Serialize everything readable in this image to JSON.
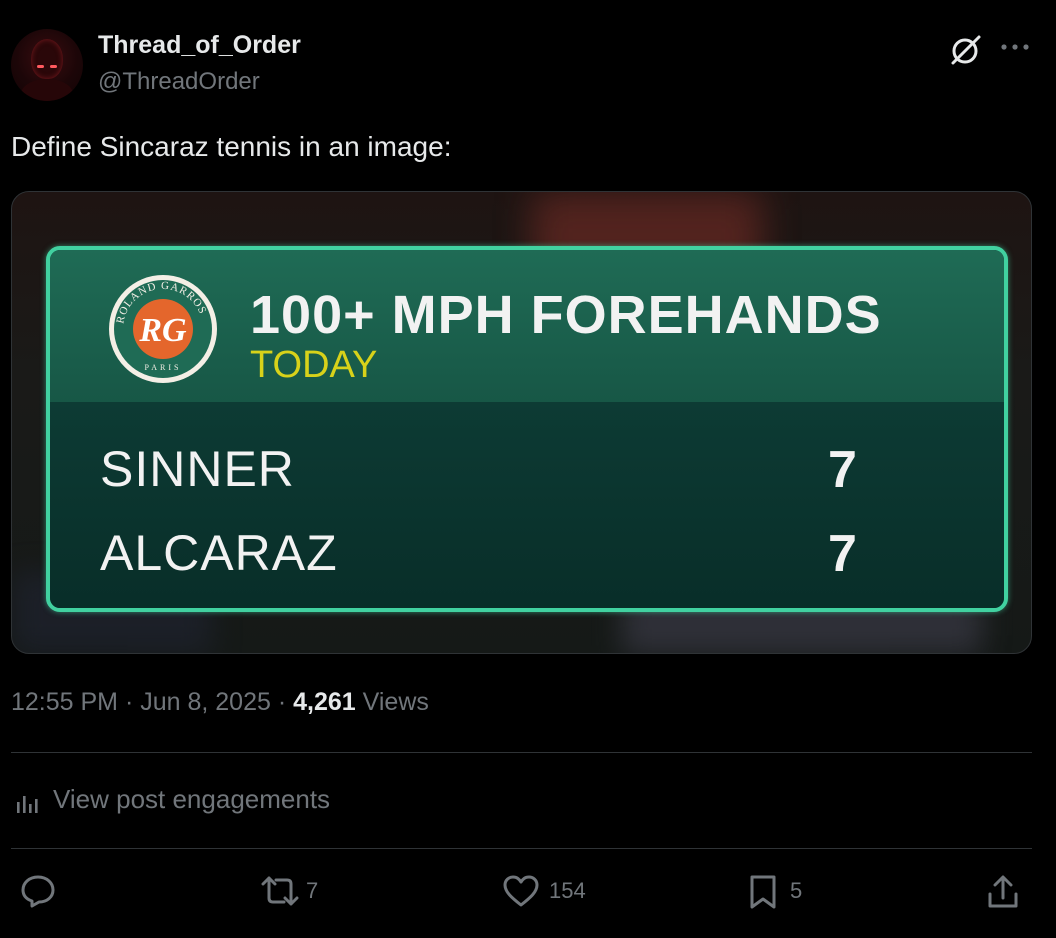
{
  "author": {
    "display_name": "Thread_of_Order",
    "handle": "@ThreadOrder"
  },
  "header_icons": [
    "grok-icon",
    "more-icon"
  ],
  "tweet": {
    "text": "Define Sincaraz tennis in an image:"
  },
  "media": {
    "logo_text": "ROLAND GARROS · PARIS",
    "title": "100+ MPH FOREHANDS",
    "subtitle": "TODAY",
    "rows": [
      {
        "player": "SINNER",
        "value": "7"
      },
      {
        "player": "ALCARAZ",
        "value": "7"
      }
    ],
    "colors": {
      "border": "#41d1a0",
      "header": "#1f6b55",
      "body": "#0d3b34",
      "subtitle": "#d8d21a"
    }
  },
  "meta": {
    "time": "12:55 PM",
    "sep1": " · ",
    "date": "Jun 8, 2025",
    "sep2": " · ",
    "views_count": "4,261",
    "views_label": " Views"
  },
  "engagements": {
    "label": "View post engagements"
  },
  "actions": {
    "reply": {
      "icon": "reply-icon",
      "count": ""
    },
    "repost": {
      "icon": "repost-icon",
      "count": "7"
    },
    "like": {
      "icon": "heart-icon",
      "count": "154"
    },
    "bookmark": {
      "icon": "bookmark-icon",
      "count": "5"
    },
    "share": {
      "icon": "share-icon",
      "count": ""
    }
  }
}
